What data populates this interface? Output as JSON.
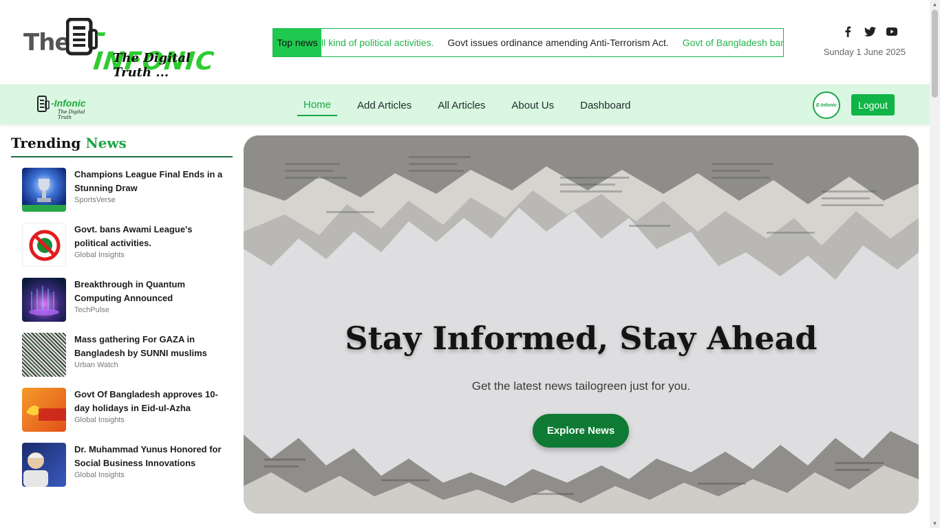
{
  "header": {
    "logo_prefix": "The",
    "logo_name": "-INFONIC",
    "logo_tagline": "The Digital Truth ...",
    "ticker_label": "Top news",
    "ticker_items": [
      "ll kind of political activities.",
      "Govt issues ordinance amending Anti-Terrorism Act.",
      "Govt of Bangladesh bans Awami L"
    ],
    "social_icons": [
      "facebook-icon",
      "twitter-icon",
      "youtube-icon"
    ],
    "date": "Sunday 1 June 2025"
  },
  "navbar": {
    "logo_name": "-Infonic",
    "logo_tagline": "The Digital Truth",
    "links": [
      "Home",
      "Add Articles",
      "All Articles",
      "About Us",
      "Dashboard"
    ],
    "active_link": "Home",
    "avatar_text": "E-Infonic",
    "logout_label": "Logout"
  },
  "trending": {
    "title_part1": "Trending",
    "title_part2": "News",
    "items": [
      {
        "title": "Champions League Final Ends in a Stunning Draw",
        "source": "SportsVerse"
      },
      {
        "title": "Govt. bans Awami League's political activities.",
        "source": "Global Insights"
      },
      {
        "title": "Breakthrough in Quantum Computing Announced",
        "source": "TechPulse"
      },
      {
        "title": "Mass gathering For GAZA in Bangladesh by SUNNI muslims",
        "source": "Urban Watch"
      },
      {
        "title": "Govt Of Bangladesh approves 10-day holidays in Eid-ul-Azha",
        "source": "Global Insights"
      },
      {
        "title": "Dr. Muhammad Yunus Honored for Social Business Innovations",
        "source": "Global Insights"
      }
    ]
  },
  "hero": {
    "title": "Stay Informed, Stay Ahead",
    "subtitle": "Get the latest news tailogreen just for you.",
    "button_label": "Explore News"
  },
  "colors": {
    "brand_green": "#1aa646",
    "nav_bg": "#d9f7e1",
    "hero_button": "#0f7a33",
    "logout_button": "#0fb546"
  }
}
